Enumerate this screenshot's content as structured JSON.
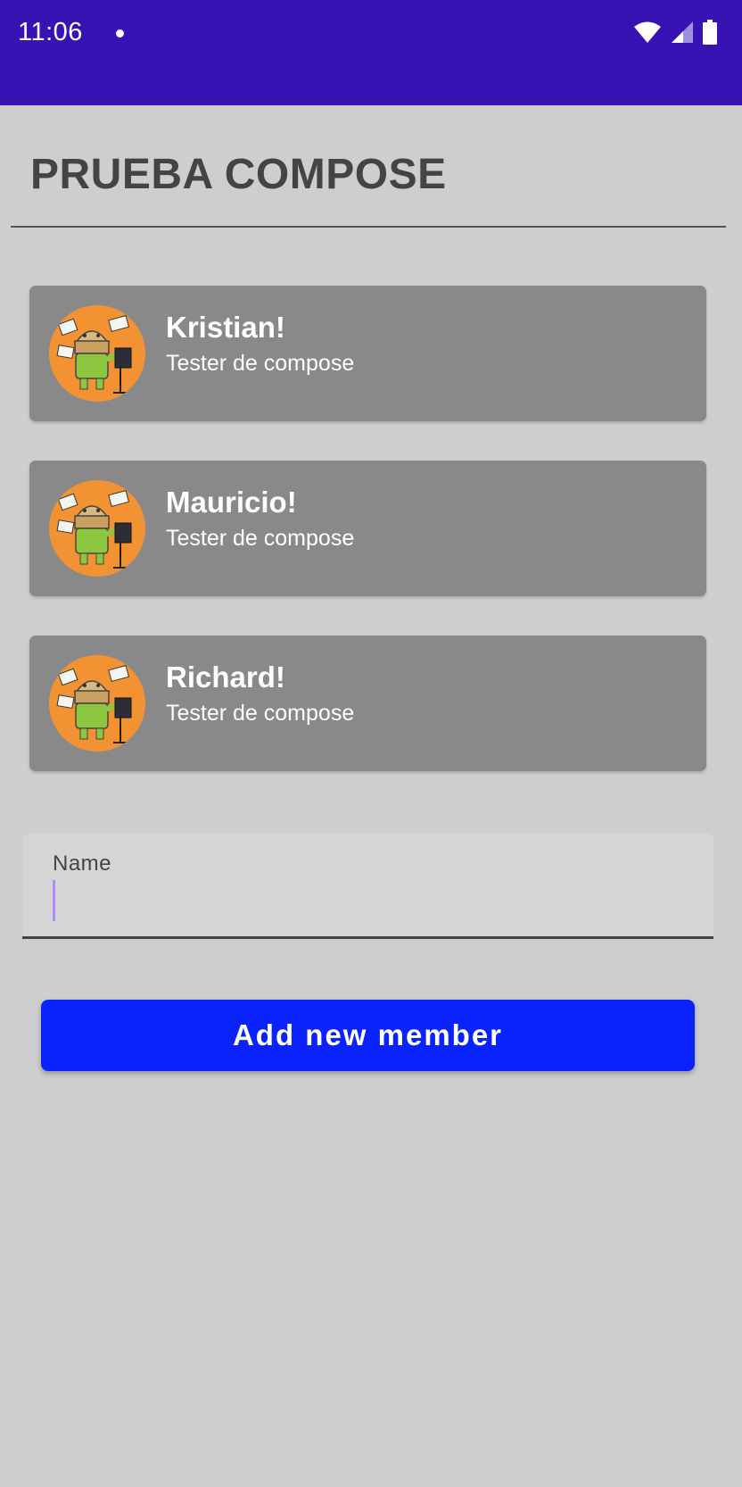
{
  "status_bar": {
    "time": "11:06",
    "icons": [
      "notification-dot-icon",
      "wifi-icon",
      "cellular-signal-icon",
      "battery-icon"
    ]
  },
  "screen": {
    "title": "PRUEBA COMPOSE"
  },
  "members": [
    {
      "name": "Kristian!",
      "role": "Tester de compose",
      "avatar_icon": "android-conductor-avatar"
    },
    {
      "name": "Mauricio!",
      "role": "Tester de compose",
      "avatar_icon": "android-conductor-avatar"
    },
    {
      "name": "Richard!",
      "role": "Tester de compose",
      "avatar_icon": "android-conductor-avatar"
    }
  ],
  "form": {
    "name_label": "Name",
    "name_value": "",
    "add_button_label": "Add new member"
  },
  "colors": {
    "status_bar": "#3713b3",
    "background": "#cecece",
    "card": "#898989",
    "avatar": "#f39233",
    "button": "#0a22fc",
    "cursor": "#b58aff"
  }
}
